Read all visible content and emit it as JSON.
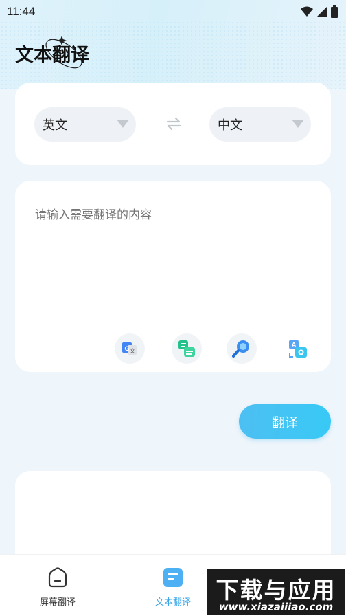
{
  "status_bar": {
    "time": "11:44"
  },
  "page": {
    "title": "文本翻译"
  },
  "languages": {
    "source": "英文",
    "target": "中文"
  },
  "input": {
    "placeholder": "请输入需要翻译的内容",
    "value": ""
  },
  "actions": {
    "translate_label": "翻译"
  },
  "tabs": [
    {
      "label": "屏幕翻译",
      "active": false
    },
    {
      "label": "文本翻译",
      "active": true
    }
  ],
  "watermark": {
    "brand": "下载与应用",
    "url": "www.xiazaiiiao.com"
  },
  "colors": {
    "accent": "#3aa6ea",
    "button": "#3fc3f4",
    "background": "#eef5fb"
  },
  "icons": [
    "wifi-icon",
    "signal-icon",
    "battery-icon",
    "swap-icon",
    "google-translate-icon",
    "text-compare-icon",
    "search-icon",
    "image-translate-icon",
    "home-tab-icon",
    "text-tab-icon"
  ]
}
